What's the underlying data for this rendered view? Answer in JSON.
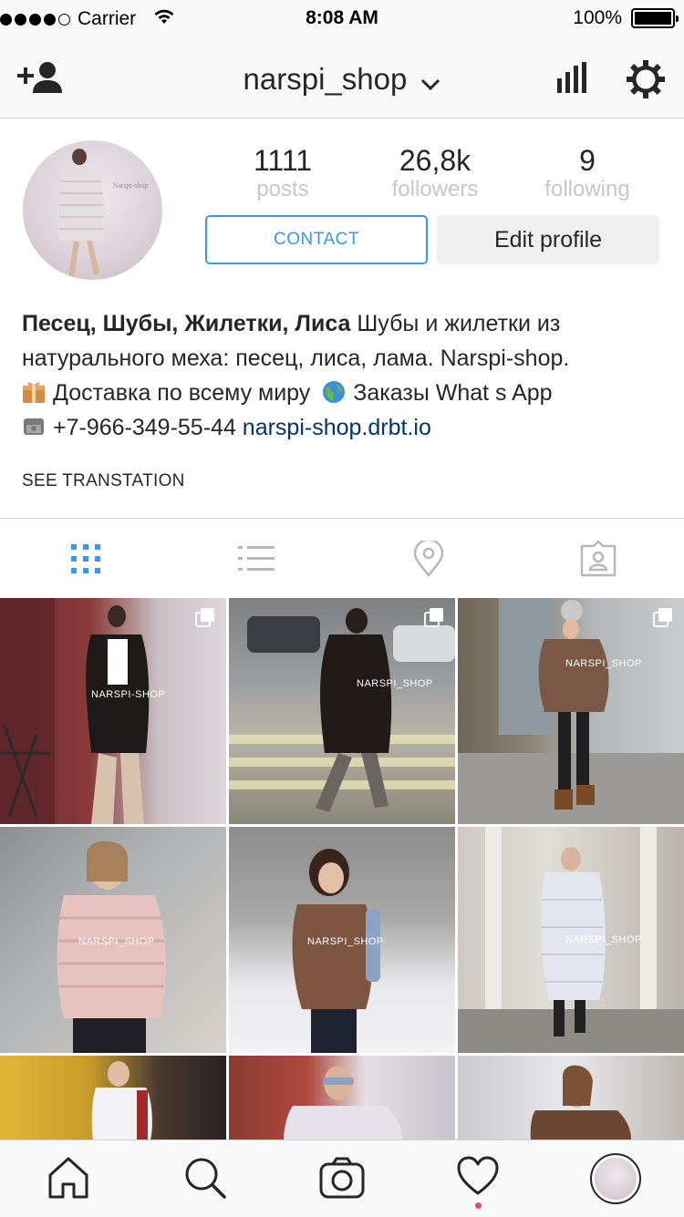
{
  "status_bar": {
    "carrier": "Carrier",
    "time": "8:08 AM",
    "battery": "100%"
  },
  "nav": {
    "username": "narspi_shop"
  },
  "profile": {
    "stats": [
      {
        "value": "1111",
        "label": "posts"
      },
      {
        "value": "26,8k",
        "label": "followers"
      },
      {
        "value": "9",
        "label": "following"
      }
    ],
    "contact_label": "CONTACT",
    "edit_label": "Edit profile",
    "avatar_watermark": "Narspi-shop"
  },
  "bio": {
    "name": "Песец, Шубы, Жилетки, Лиса",
    "text_line1": " Шубы и жилетки из",
    "text_line2": "натурального меха: песец, лиса, лама. Narspi-shop.",
    "delivery": "Доставка по всему миру",
    "orders": "Заказы What s App",
    "phone": "+7-966-349-55-44",
    "link": "narspi-shop.drbt.io",
    "see_translation": "SEE TRANSTATION"
  },
  "grid": {
    "watermarks": [
      "NARSPI-SHOP",
      "NARSPI_SHOP",
      "NARSPI_SHOP",
      "NARSPI_SHOP",
      "NARSPI_SHOP",
      "NARSPI_SHOP"
    ]
  },
  "icons": {
    "nav_left": "add-user-icon",
    "nav_right": [
      "insights-icon",
      "settings-gear-icon"
    ],
    "tabs": [
      "grid-view-icon",
      "list-view-icon",
      "location-pin-icon",
      "tagged-photos-icon"
    ],
    "bottom": [
      "home-icon",
      "search-icon",
      "camera-icon",
      "heart-icon",
      "profile-avatar"
    ]
  },
  "colors": {
    "accent": "#3897f0",
    "link": "#003569",
    "muted": "#c7c7c7",
    "notification": "#ed4956"
  }
}
